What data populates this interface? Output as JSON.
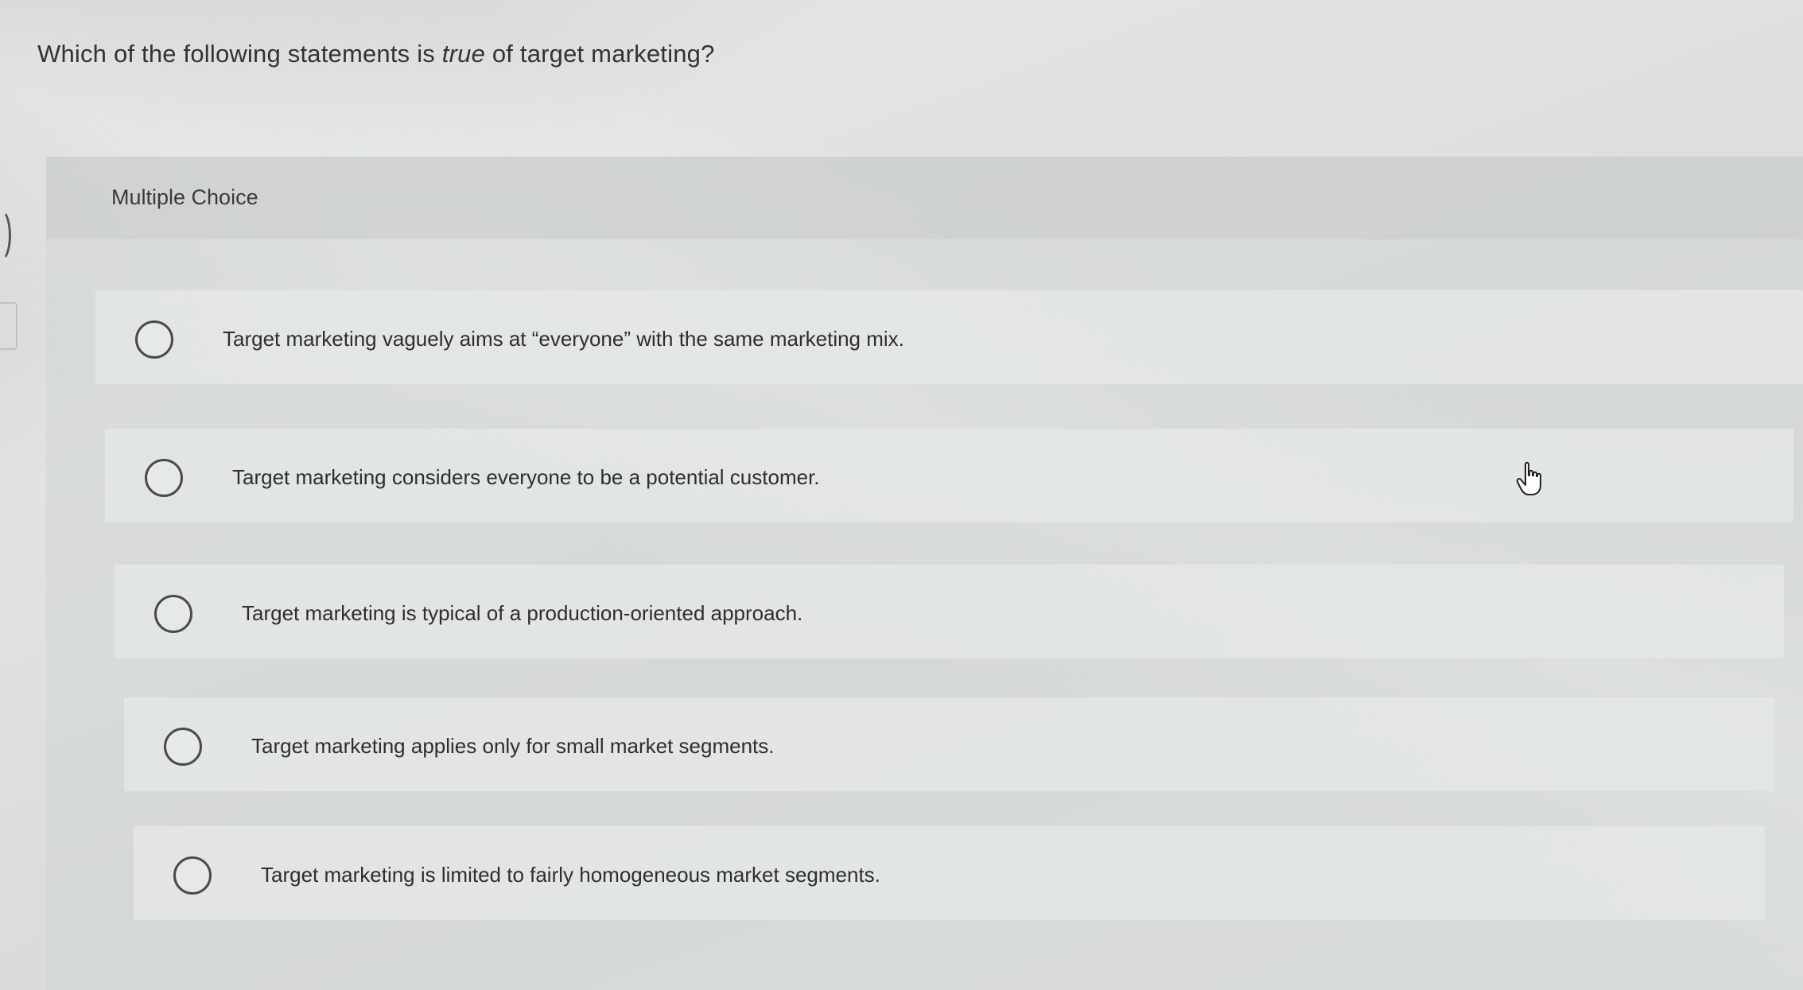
{
  "question": {
    "prefix": "Which of the following statements is ",
    "emphasis": "true",
    "suffix": " of target marketing?"
  },
  "panel": {
    "header_label": "Multiple Choice"
  },
  "options": [
    {
      "label": "Target marketing vaguely aims at “everyone” with the same marketing mix."
    },
    {
      "label": "Target marketing considers everyone to be a potential customer."
    },
    {
      "label": "Target marketing is typical of a production-oriented approach."
    },
    {
      "label": "Target marketing applies only for small market segments."
    },
    {
      "label": "Target marketing is limited to fairly homogeneous market segments."
    }
  ],
  "icons": {
    "radio": "radio-unselected-icon",
    "cursor": "hand-pointer-icon"
  }
}
